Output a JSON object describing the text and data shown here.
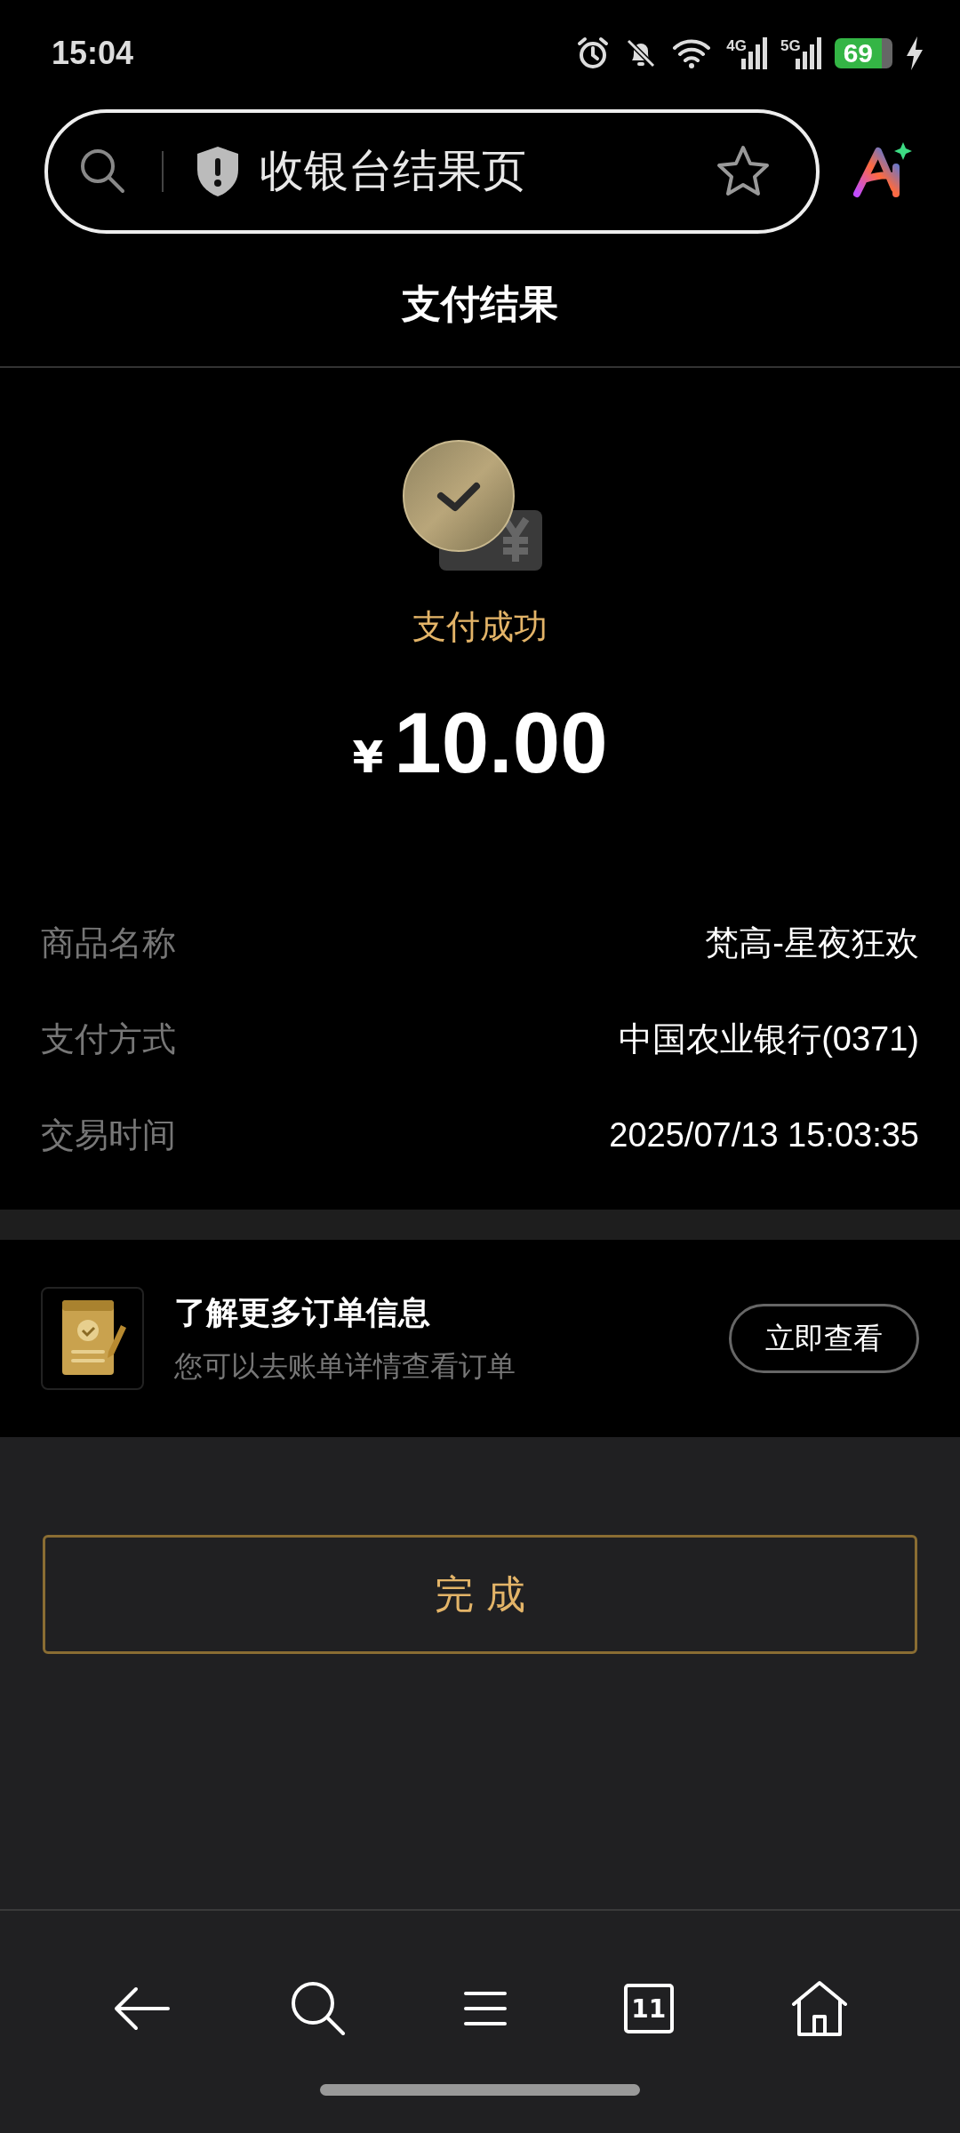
{
  "status_bar": {
    "time": "15:04",
    "network_1": "4G",
    "network_2": "5G",
    "battery": "69"
  },
  "address_bar": {
    "title": "收银台结果页",
    "bookmarked": false
  },
  "page_title": "支付结果",
  "result": {
    "status": "支付成功",
    "currency": "¥",
    "amount": "10.00"
  },
  "details": [
    {
      "label": "商品名称",
      "value": "梵高-星夜狂欢"
    },
    {
      "label": "支付方式",
      "value": "中国农业银行(0371)"
    },
    {
      "label": "交易时间",
      "value": "2025/07/13 15:03:35"
    }
  ],
  "order_card": {
    "title": "了解更多订单信息",
    "subtitle": "您可以去账单详情查看订单",
    "button": "立即查看"
  },
  "done_button": "完 成",
  "nav_bar": {
    "tab_count": "11"
  }
}
